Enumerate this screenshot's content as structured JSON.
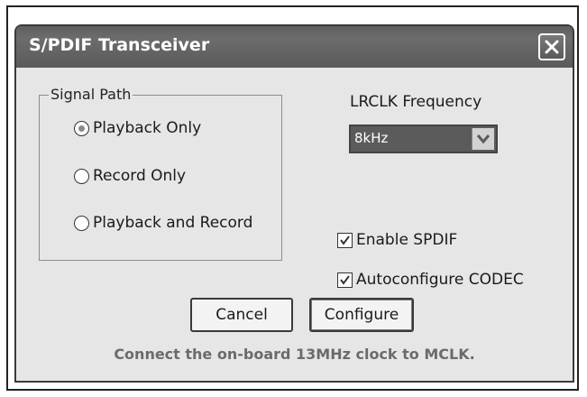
{
  "window": {
    "title": "S/PDIF Transceiver"
  },
  "signal_path": {
    "legend": "Signal Path",
    "options": [
      {
        "label": "Playback Only",
        "selected": true
      },
      {
        "label": "Record Only",
        "selected": false
      },
      {
        "label": "Playback and Record",
        "selected": false
      }
    ]
  },
  "lrclk": {
    "label": "LRCLK Frequency",
    "selected_value": "8kHz"
  },
  "checkboxes": [
    {
      "label": "Enable SPDIF",
      "checked": true
    },
    {
      "label": "Autoconfigure CODEC",
      "checked": true
    }
  ],
  "buttons": {
    "cancel_label": "Cancel",
    "configure_label": "Configure"
  },
  "status_text": "Connect the on-board 13MHz clock to MCLK.",
  "icons": {
    "close": "close-icon",
    "dropdown": "chevron-down-icon",
    "check": "checkmark-icon"
  }
}
